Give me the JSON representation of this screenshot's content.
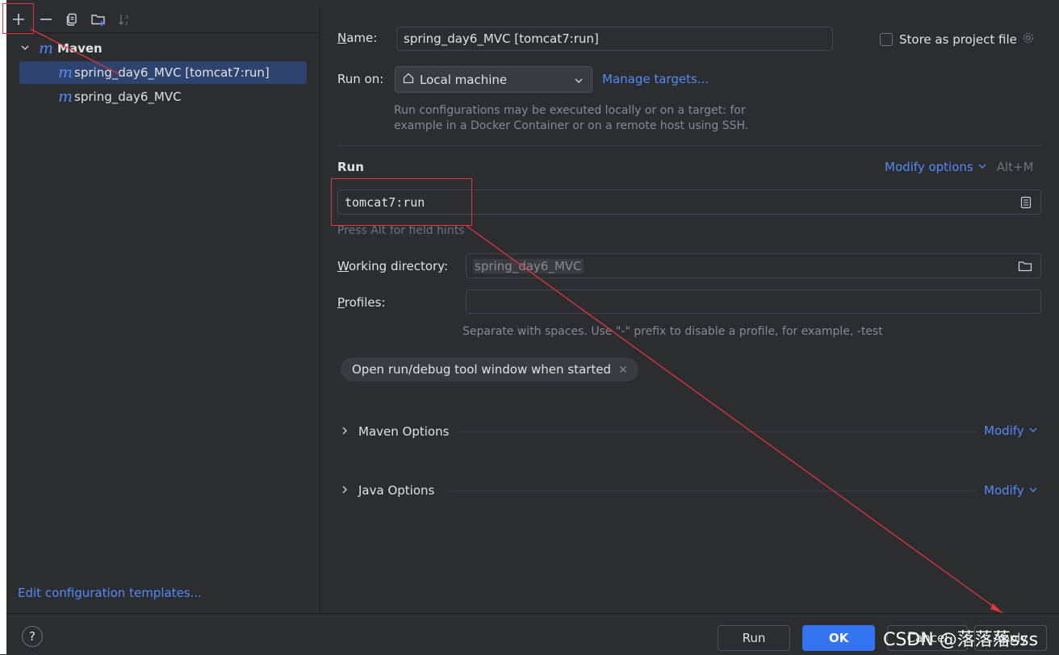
{
  "sidebar": {
    "toolbar_icons": [
      "add-icon",
      "remove-icon",
      "copy-icon",
      "new-folder-icon",
      "sort-icon"
    ],
    "group_label": "Maven",
    "items": [
      {
        "label": "spring_day6_MVC [tomcat7:run]",
        "selected": true
      },
      {
        "label": "spring_day6_MVC",
        "selected": false
      }
    ],
    "edit_templates_link": "Edit configuration templates..."
  },
  "form": {
    "name_label": "Name:",
    "name_value": "spring_day6_MVC [tomcat7:run]",
    "store_project_label": "Store as project file",
    "store_project_checked": false,
    "run_on_label": "Run on:",
    "run_on_value": "Local machine",
    "manage_targets": "Manage targets...",
    "run_on_hint_line1": "Run configurations may be executed locally or on a target: for",
    "run_on_hint_line2": "example in a Docker Container or on a remote host using SSH.",
    "run_section_title": "Run",
    "modify_options": "Modify options",
    "modify_shortcut": "Alt+M",
    "command_value": "tomcat7:run",
    "field_hint": "Press Alt for field hints",
    "working_dir_label": "Working directory:",
    "working_dir_value": "spring_day6_MVC",
    "profiles_label": "Profiles:",
    "profiles_value": "",
    "profiles_hint": "Separate with spaces. Use \"-\" prefix to disable a profile, for example, -test",
    "chip_label": "Open run/debug tool window when started",
    "maven_options": "Maven Options",
    "java_options": "Java Options",
    "modify_label": "Modify"
  },
  "footer": {
    "help": "?",
    "run": "Run",
    "ok": "OK",
    "cancel": "Cancel",
    "apply": "Apply",
    "watermark": "CSDN @落落落sss"
  },
  "colors": {
    "background": "#2b2d30",
    "accent": "#548af7",
    "primary_button": "#3574f0",
    "selection": "#2e436e",
    "annotation_red": "#e0363e"
  }
}
